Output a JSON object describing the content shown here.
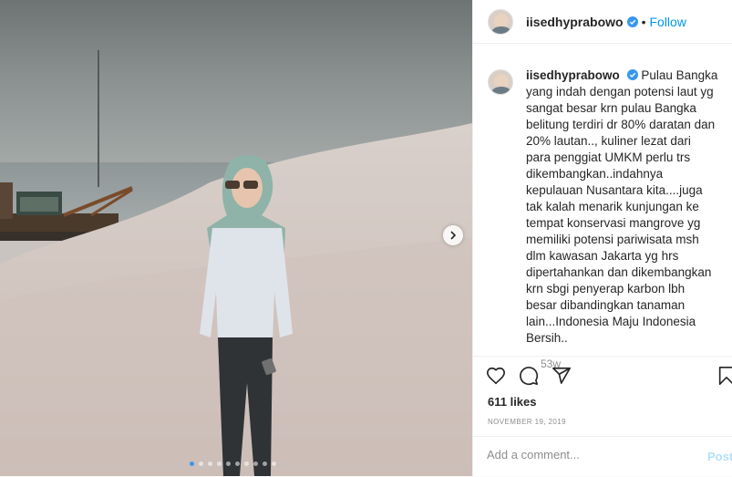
{
  "header": {
    "username": "iisedhyprabowo",
    "separator": "•",
    "follow_label": "Follow"
  },
  "caption": {
    "username": "iisedhyprabowo",
    "text": "Pulau Bangka yang indah dengan potensi laut yg sangat besar krn pulau Bangka belitung terdiri dr 80% daratan dan 20% lautan.., kuliner lezat dari para penggiat UMKM perlu trs dikembangkan..indahnya kepulauan Nusantara kita....juga tak kalah menarik kunjungan ke tempat konservasi mangrove yg memiliki potensi pariwisata msh dlm kawasan Jakarta yg hrs dipertahankan dan dikembangkan krn sbgi penyerap karbon lbh besar dibandingkan tanaman lain...Indonesia Maju Indonesia Bersih..",
    "age": "53w"
  },
  "actions": {
    "likes": "611 likes",
    "date": "November 19, 2019"
  },
  "comment_box": {
    "placeholder": "Add a comment...",
    "post_label": "Post"
  },
  "carousel": {
    "total": 10,
    "active_index": 0
  },
  "colors": {
    "link": "#0095f6",
    "verified": "#3897f0",
    "muted": "#8e8e8e"
  },
  "icons": [
    "heart-icon",
    "comment-icon",
    "share-icon",
    "bookmark-icon",
    "verified-badge-icon",
    "chevron-right-icon"
  ]
}
